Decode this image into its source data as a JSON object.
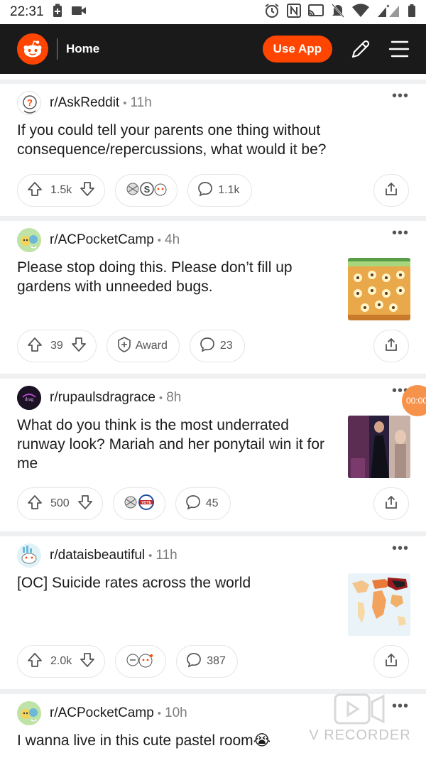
{
  "status_bar": {
    "time": "22:31"
  },
  "header": {
    "title": "Home",
    "use_app": "Use App",
    "brand_color": "#ff4500"
  },
  "posts": [
    {
      "subreddit": "r/AskReddit",
      "age": "11h",
      "title": "If you could tell your parents one thing without consequence/repercussions, what would it be?",
      "votes": "1.5k",
      "comments": "1.1k",
      "has_thumbnail": false
    },
    {
      "subreddit": "r/ACPocketCamp",
      "age": "4h",
      "title": "Please stop doing this. Please don’t fill up gardens with unneeded bugs.",
      "votes": "39",
      "award_label": "Award",
      "comments": "23",
      "has_thumbnail": true
    },
    {
      "subreddit": "r/rupaulsdragrace",
      "age": "8h",
      "title": "What do you think is the most underrated runway look? Mariah and her ponytail win it for me",
      "votes": "500",
      "comments": "45",
      "has_thumbnail": true
    },
    {
      "subreddit": "r/dataisbeautiful",
      "age": "11h",
      "title": "[OC] Suicide rates across the world",
      "votes": "2.0k",
      "comments": "387",
      "has_thumbnail": true
    },
    {
      "subreddit": "r/ACPocketCamp",
      "age": "10h",
      "title": "I wanna live in this cute pastel room😭"
    }
  ],
  "overlay": {
    "recorder_label": "V RECORDER",
    "timer": "00:00"
  }
}
